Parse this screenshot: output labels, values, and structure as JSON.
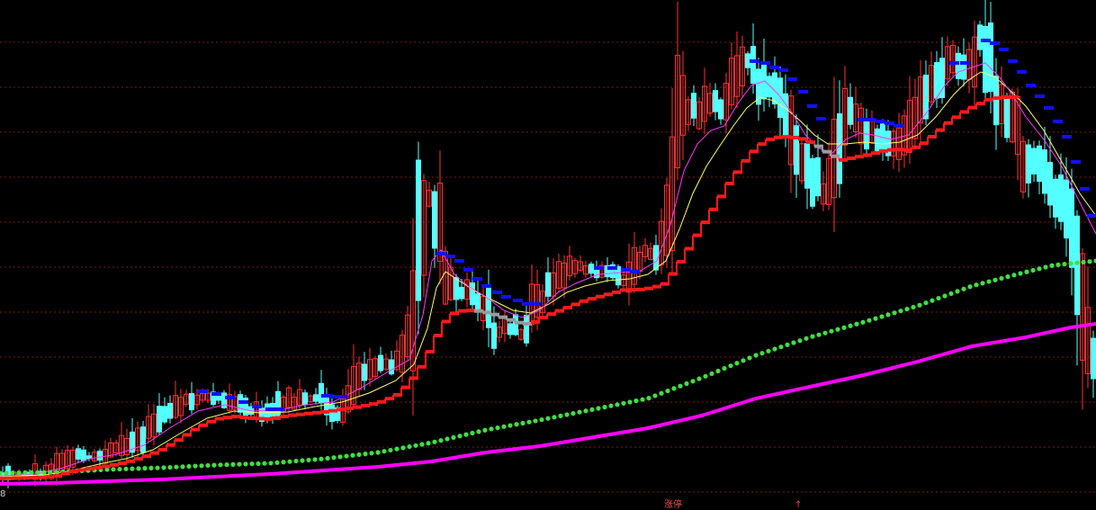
{
  "colors": {
    "background": "#000000",
    "grid": "#7a1a1a",
    "candle_up": "#ff3030",
    "candle_down": "#54ffff",
    "ma_fast": "#ff38ff",
    "ma_slow": "#ffff66",
    "stair_red": "#ff1a1a",
    "stair_gray": "#9a9a9a",
    "stair_blue": "#1010ff",
    "dots_green": "#40e040",
    "line_magenta": "#ff00ff"
  },
  "labels": {
    "bottom_left": "8",
    "bottom_mid": "涨停",
    "bottom_right": "↑"
  },
  "chart_data": {
    "type": "candlestick",
    "grid": true,
    "legend": "none",
    "ylim": [
      0,
      567
    ],
    "price_anchors": [
      [
        0,
        530
      ],
      [
        30,
        530
      ],
      [
        55,
        525
      ],
      [
        80,
        508
      ],
      [
        110,
        508
      ],
      [
        140,
        497
      ],
      [
        160,
        485
      ],
      [
        175,
        465
      ],
      [
        190,
        455
      ],
      [
        210,
        445
      ],
      [
        230,
        440
      ],
      [
        250,
        442
      ],
      [
        270,
        452
      ],
      [
        300,
        462
      ],
      [
        320,
        447
      ],
      [
        345,
        443
      ],
      [
        360,
        443
      ],
      [
        372,
        462
      ],
      [
        385,
        455
      ],
      [
        400,
        420
      ],
      [
        415,
        410
      ],
      [
        430,
        408
      ],
      [
        445,
        402
      ],
      [
        460,
        360
      ],
      [
        470,
        240
      ],
      [
        478,
        220
      ],
      [
        485,
        245
      ],
      [
        495,
        300
      ],
      [
        510,
        325
      ],
      [
        525,
        330
      ],
      [
        540,
        345
      ],
      [
        550,
        372
      ],
      [
        565,
        362
      ],
      [
        580,
        372
      ],
      [
        595,
        342
      ],
      [
        610,
        322
      ],
      [
        625,
        302
      ],
      [
        640,
        297
      ],
      [
        660,
        300
      ],
      [
        680,
        305
      ],
      [
        695,
        315
      ],
      [
        705,
        295
      ],
      [
        715,
        282
      ],
      [
        730,
        285
      ],
      [
        745,
        235
      ],
      [
        755,
        140
      ],
      [
        765,
        120
      ],
      [
        775,
        125
      ],
      [
        790,
        110
      ],
      [
        805,
        120
      ],
      [
        818,
        90
      ],
      [
        830,
        70
      ],
      [
        838,
        80
      ],
      [
        848,
        100
      ],
      [
        860,
        105
      ],
      [
        875,
        125
      ],
      [
        885,
        165
      ],
      [
        895,
        180
      ],
      [
        905,
        200
      ],
      [
        915,
        220
      ],
      [
        925,
        205
      ],
      [
        935,
        150
      ],
      [
        945,
        130
      ],
      [
        960,
        145
      ],
      [
        975,
        155
      ],
      [
        990,
        168
      ],
      [
        1005,
        160
      ],
      [
        1020,
        125
      ],
      [
        1035,
        100
      ],
      [
        1050,
        80
      ],
      [
        1065,
        70
      ],
      [
        1080,
        70
      ],
      [
        1088,
        40
      ],
      [
        1095,
        55
      ],
      [
        1105,
        100
      ],
      [
        1115,
        118
      ],
      [
        1125,
        135
      ],
      [
        1140,
        185
      ],
      [
        1155,
        190
      ],
      [
        1170,
        215
      ],
      [
        1185,
        245
      ],
      [
        1195,
        290
      ],
      [
        1203,
        345
      ],
      [
        1210,
        385
      ],
      [
        1218,
        400
      ]
    ],
    "ma_fast": [
      [
        0,
        529
      ],
      [
        40,
        527
      ],
      [
        70,
        520
      ],
      [
        100,
        510
      ],
      [
        130,
        505
      ],
      [
        160,
        495
      ],
      [
        190,
        475
      ],
      [
        220,
        457
      ],
      [
        250,
        450
      ],
      [
        280,
        457
      ],
      [
        310,
        456
      ],
      [
        340,
        450
      ],
      [
        370,
        447
      ],
      [
        400,
        432
      ],
      [
        430,
        414
      ],
      [
        455,
        400
      ],
      [
        470,
        350
      ],
      [
        480,
        290
      ],
      [
        490,
        278
      ],
      [
        505,
        305
      ],
      [
        520,
        318
      ],
      [
        540,
        330
      ],
      [
        560,
        345
      ],
      [
        580,
        353
      ],
      [
        600,
        345
      ],
      [
        620,
        325
      ],
      [
        640,
        315
      ],
      [
        665,
        305
      ],
      [
        690,
        303
      ],
      [
        710,
        302
      ],
      [
        730,
        290
      ],
      [
        745,
        250
      ],
      [
        760,
        190
      ],
      [
        775,
        160
      ],
      [
        790,
        145
      ],
      [
        805,
        140
      ],
      [
        820,
        115
      ],
      [
        835,
        95
      ],
      [
        850,
        90
      ],
      [
        865,
        105
      ],
      [
        880,
        125
      ],
      [
        895,
        150
      ],
      [
        910,
        165
      ],
      [
        925,
        170
      ],
      [
        940,
        155
      ],
      [
        955,
        148
      ],
      [
        970,
        150
      ],
      [
        990,
        155
      ],
      [
        1010,
        150
      ],
      [
        1030,
        125
      ],
      [
        1050,
        95
      ],
      [
        1065,
        80
      ],
      [
        1080,
        75
      ],
      [
        1095,
        70
      ],
      [
        1110,
        85
      ],
      [
        1125,
        105
      ],
      [
        1140,
        130
      ],
      [
        1160,
        155
      ],
      [
        1180,
        185
      ],
      [
        1200,
        225
      ],
      [
        1218,
        260
      ]
    ],
    "ma_slow": [
      [
        0,
        530
      ],
      [
        50,
        528
      ],
      [
        80,
        523
      ],
      [
        110,
        516
      ],
      [
        140,
        510
      ],
      [
        170,
        500
      ],
      [
        200,
        482
      ],
      [
        230,
        465
      ],
      [
        260,
        457
      ],
      [
        290,
        459
      ],
      [
        320,
        458
      ],
      [
        350,
        452
      ],
      [
        380,
        447
      ],
      [
        410,
        437
      ],
      [
        440,
        423
      ],
      [
        460,
        405
      ],
      [
        475,
        365
      ],
      [
        485,
        320
      ],
      [
        495,
        302
      ],
      [
        510,
        312
      ],
      [
        530,
        325
      ],
      [
        550,
        335
      ],
      [
        570,
        345
      ],
      [
        590,
        348
      ],
      [
        610,
        338
      ],
      [
        630,
        325
      ],
      [
        650,
        318
      ],
      [
        675,
        312
      ],
      [
        700,
        310
      ],
      [
        720,
        305
      ],
      [
        740,
        290
      ],
      [
        755,
        255
      ],
      [
        770,
        215
      ],
      [
        785,
        185
      ],
      [
        800,
        162
      ],
      [
        815,
        140
      ],
      [
        830,
        120
      ],
      [
        845,
        108
      ],
      [
        860,
        112
      ],
      [
        875,
        122
      ],
      [
        890,
        135
      ],
      [
        905,
        150
      ],
      [
        920,
        160
      ],
      [
        940,
        160
      ],
      [
        960,
        158
      ],
      [
        980,
        160
      ],
      [
        1000,
        158
      ],
      [
        1020,
        150
      ],
      [
        1040,
        130
      ],
      [
        1060,
        105
      ],
      [
        1075,
        90
      ],
      [
        1090,
        80
      ],
      [
        1105,
        85
      ],
      [
        1120,
        98
      ],
      [
        1140,
        118
      ],
      [
        1160,
        145
      ],
      [
        1180,
        180
      ],
      [
        1200,
        215
      ],
      [
        1218,
        240
      ]
    ],
    "stair_points": [
      [
        0,
        532
      ],
      [
        40,
        531
      ],
      [
        60,
        530
      ],
      [
        80,
        524
      ],
      [
        100,
        521
      ],
      [
        120,
        518
      ],
      [
        140,
        514
      ],
      [
        160,
        508
      ],
      [
        180,
        500
      ],
      [
        200,
        488
      ],
      [
        220,
        475
      ],
      [
        240,
        466
      ],
      [
        260,
        463
      ],
      [
        280,
        465
      ],
      [
        300,
        466
      ],
      [
        320,
        462
      ],
      [
        340,
        460
      ],
      [
        360,
        458
      ],
      [
        380,
        455
      ],
      [
        400,
        452
      ],
      [
        420,
        448
      ],
      [
        440,
        440
      ],
      [
        455,
        426
      ],
      [
        470,
        405
      ],
      [
        480,
        385
      ],
      [
        490,
        365
      ],
      [
        500,
        350
      ],
      [
        510,
        346
      ],
      [
        520,
        345
      ],
      [
        535,
        346
      ],
      [
        550,
        350
      ],
      [
        565,
        355
      ],
      [
        580,
        360
      ],
      [
        590,
        360
      ],
      [
        605,
        352
      ],
      [
        620,
        346
      ],
      [
        635,
        340
      ],
      [
        650,
        334
      ],
      [
        665,
        330
      ],
      [
        680,
        326
      ],
      [
        695,
        322
      ],
      [
        710,
        322
      ],
      [
        725,
        320
      ],
      [
        740,
        315
      ],
      [
        750,
        300
      ],
      [
        760,
        285
      ],
      [
        770,
        268
      ],
      [
        780,
        252
      ],
      [
        790,
        236
      ],
      [
        800,
        220
      ],
      [
        810,
        204
      ],
      [
        820,
        190
      ],
      [
        830,
        176
      ],
      [
        840,
        165
      ],
      [
        850,
        157
      ],
      [
        860,
        153
      ],
      [
        875,
        152
      ],
      [
        890,
        154
      ],
      [
        905,
        160
      ],
      [
        920,
        170
      ],
      [
        935,
        178
      ],
      [
        950,
        175
      ],
      [
        965,
        172
      ],
      [
        980,
        168
      ],
      [
        995,
        166
      ],
      [
        1010,
        167
      ],
      [
        1025,
        160
      ],
      [
        1040,
        148
      ],
      [
        1055,
        135
      ],
      [
        1070,
        125
      ],
      [
        1085,
        117
      ],
      [
        1100,
        110
      ],
      [
        1115,
        108
      ],
      [
        1125,
        108
      ]
    ],
    "gray_segments": [
      [
        528,
        590
      ],
      [
        905,
        935
      ],
      [
        1130,
        1200
      ]
    ],
    "blue_steps": [
      [
        225,
        435
      ],
      [
        240,
        438
      ],
      [
        255,
        442
      ],
      [
        270,
        447
      ],
      [
        285,
        452
      ],
      [
        300,
        455
      ],
      [
        310,
        455
      ],
      [
        362,
        440
      ],
      [
        372,
        441
      ],
      [
        380,
        441
      ],
      [
        490,
        282
      ],
      [
        500,
        285
      ],
      [
        510,
        290
      ],
      [
        520,
        300
      ],
      [
        530,
        310
      ],
      [
        540,
        318
      ],
      [
        552,
        325
      ],
      [
        562,
        330
      ],
      [
        575,
        334
      ],
      [
        585,
        338
      ],
      [
        595,
        338
      ],
      [
        665,
        298
      ],
      [
        680,
        298
      ],
      [
        695,
        300
      ],
      [
        705,
        302
      ],
      [
        838,
        68
      ],
      [
        850,
        70
      ],
      [
        860,
        75
      ],
      [
        870,
        78
      ],
      [
        880,
        88
      ],
      [
        892,
        102
      ],
      [
        902,
        118
      ],
      [
        912,
        132
      ],
      [
        958,
        133
      ],
      [
        968,
        133
      ],
      [
        978,
        135
      ],
      [
        988,
        137
      ],
      [
        998,
        140
      ],
      [
        1060,
        70
      ],
      [
        1072,
        70
      ],
      [
        1095,
        45
      ],
      [
        1105,
        48
      ],
      [
        1115,
        55
      ],
      [
        1125,
        68
      ],
      [
        1135,
        80
      ],
      [
        1145,
        95
      ],
      [
        1155,
        107
      ],
      [
        1165,
        120
      ],
      [
        1175,
        135
      ],
      [
        1185,
        152
      ],
      [
        1195,
        180
      ],
      [
        1205,
        210
      ],
      [
        1213,
        240
      ]
    ],
    "green_dots": [
      [
        0,
        526
      ],
      [
        60,
        525
      ],
      [
        120,
        522
      ],
      [
        180,
        520
      ],
      [
        240,
        517
      ],
      [
        300,
        515
      ],
      [
        360,
        510
      ],
      [
        420,
        503
      ],
      [
        480,
        492
      ],
      [
        540,
        478
      ],
      [
        600,
        467
      ],
      [
        660,
        455
      ],
      [
        720,
        443
      ],
      [
        780,
        420
      ],
      [
        840,
        395
      ],
      [
        900,
        375
      ],
      [
        960,
        358
      ],
      [
        1020,
        340
      ],
      [
        1080,
        318
      ],
      [
        1130,
        305
      ],
      [
        1170,
        295
      ],
      [
        1218,
        290
      ]
    ],
    "magenta_line": [
      [
        0,
        538
      ],
      [
        60,
        537
      ],
      [
        120,
        535
      ],
      [
        180,
        533
      ],
      [
        240,
        530
      ],
      [
        300,
        527
      ],
      [
        360,
        523
      ],
      [
        420,
        519
      ],
      [
        480,
        513
      ],
      [
        540,
        503
      ],
      [
        600,
        496
      ],
      [
        660,
        486
      ],
      [
        720,
        476
      ],
      [
        780,
        462
      ],
      [
        840,
        443
      ],
      [
        900,
        430
      ],
      [
        960,
        417
      ],
      [
        1020,
        402
      ],
      [
        1080,
        385
      ],
      [
        1140,
        375
      ],
      [
        1190,
        364
      ],
      [
        1218,
        360
      ]
    ]
  }
}
